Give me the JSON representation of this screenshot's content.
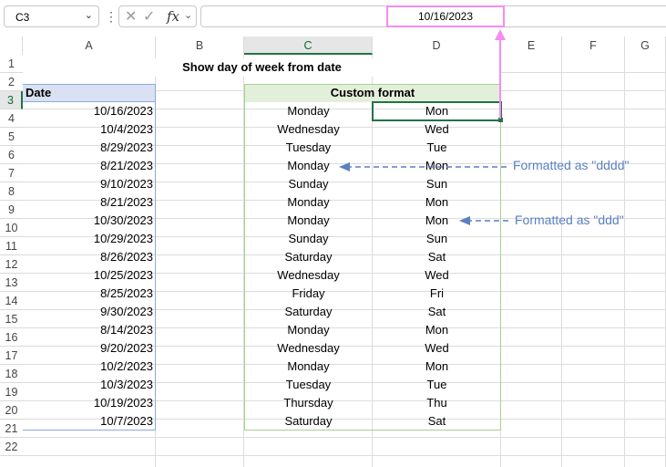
{
  "formula_bar": {
    "name_box": "C3",
    "formula": "10/16/2023"
  },
  "columns": [
    "A",
    "B",
    "C",
    "D",
    "E",
    "F",
    "G"
  ],
  "rows": [
    "1",
    "2",
    "3",
    "4",
    "5",
    "6",
    "7",
    "8",
    "9",
    "10",
    "11",
    "12",
    "13",
    "14",
    "15",
    "16",
    "17",
    "18",
    "19",
    "20",
    "21",
    "22"
  ],
  "sheet": {
    "title": "Show day of week from date",
    "date_header": "Date",
    "custom_header": "Custom format",
    "dates": [
      "10/16/2023",
      "10/4/2023",
      "8/29/2023",
      "8/21/2023",
      "9/10/2023",
      "8/21/2023",
      "10/30/2023",
      "10/29/2023",
      "8/26/2023",
      "10/25/2023",
      "8/25/2023",
      "9/30/2023",
      "8/14/2023",
      "9/20/2023",
      "10/2/2023",
      "10/3/2023",
      "10/19/2023",
      "10/7/2023"
    ],
    "long_days": [
      "Monday",
      "Wednesday",
      "Tuesday",
      "Monday",
      "Sunday",
      "Monday",
      "Monday",
      "Sunday",
      "Saturday",
      "Wednesday",
      "Friday",
      "Saturday",
      "Monday",
      "Wednesday",
      "Monday",
      "Tuesday",
      "Thursday",
      "Saturday"
    ],
    "short_days": [
      "Mon",
      "Wed",
      "Tue",
      "Mon",
      "Sun",
      "Mon",
      "Mon",
      "Sun",
      "Sat",
      "Wed",
      "Fri",
      "Sat",
      "Mon",
      "Wed",
      "Mon",
      "Tue",
      "Thu",
      "Sat"
    ]
  },
  "annotations": {
    "dddd": "Formatted as \"dddd\"",
    "ddd": "Formatted as \"ddd\""
  },
  "colors": {
    "date_header_fill": "#d9e1f2",
    "custom_header_fill": "#e2efda",
    "selection": "#217346",
    "pink_marker": "#f58cf0",
    "annotation": "#5a7fc2"
  }
}
